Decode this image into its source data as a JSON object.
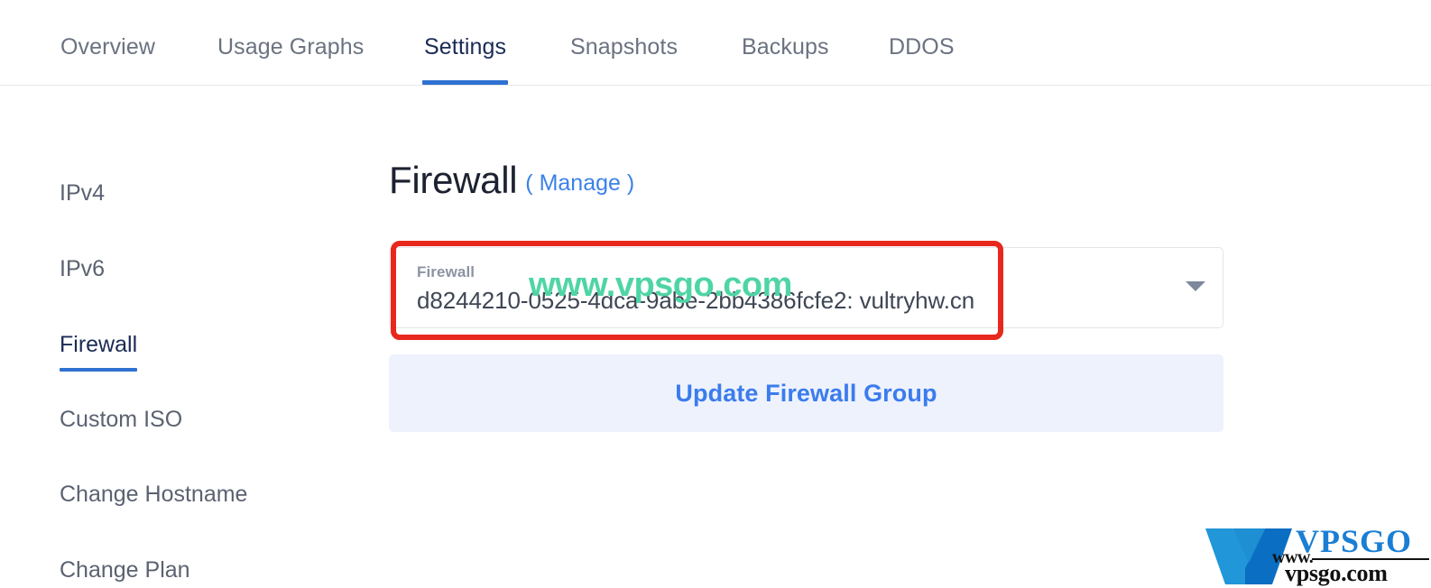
{
  "tabs": [
    {
      "label": "Overview",
      "active": false
    },
    {
      "label": "Usage Graphs",
      "active": false
    },
    {
      "label": "Settings",
      "active": true
    },
    {
      "label": "Snapshots",
      "active": false
    },
    {
      "label": "Backups",
      "active": false
    },
    {
      "label": "DDOS",
      "active": false
    }
  ],
  "sidebar": {
    "items": [
      {
        "label": "IPv4",
        "active": false
      },
      {
        "label": "IPv6",
        "active": false
      },
      {
        "label": "Firewall",
        "active": true
      },
      {
        "label": "Custom ISO",
        "active": false
      },
      {
        "label": "Change Hostname",
        "active": false
      },
      {
        "label": "Change Plan",
        "active": false
      }
    ]
  },
  "main": {
    "heading": {
      "title": "Firewall",
      "manage_link": "( Manage )"
    },
    "firewall_select": {
      "label": "Firewall",
      "value": "d8244210-0525-4dca-9abe-2bb4386fcfe2: vultryhw.cn",
      "chevron_icon": "chevron-down-icon"
    },
    "update_button": {
      "label": "Update Firewall Group"
    }
  },
  "annotations": {
    "highlight_box": {
      "shape": "rectangle",
      "color": "#e8281c"
    }
  },
  "watermarks": {
    "green_text": "www.vpsgo.com",
    "green_color": "#4fd5a5",
    "logo": {
      "mark": "v-letter-logo",
      "brand": "VPSGO",
      "prefix": "www.",
      "domain": "vpsgo.com",
      "brand_color": "#1a7fd4"
    }
  },
  "theme": {
    "accent_blue": "#2f71d0",
    "link_blue": "#3b82e8",
    "button_bg": "#eef2fd",
    "heading_color": "#1c2230",
    "muted_text": "#6b7280"
  }
}
